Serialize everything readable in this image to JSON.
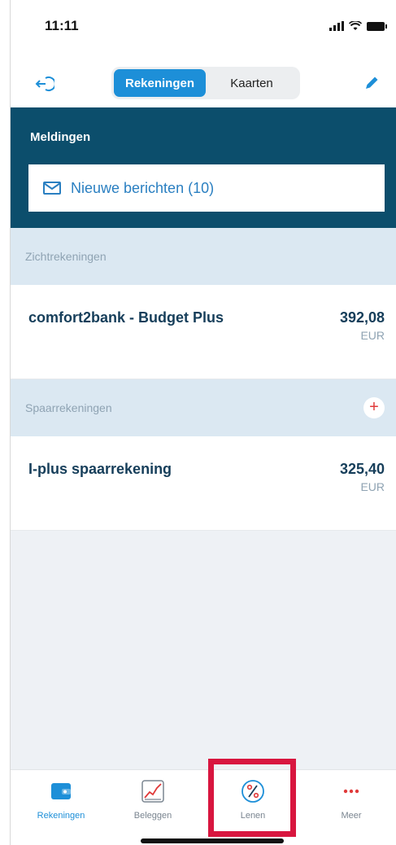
{
  "status_bar": {
    "time": "11:11"
  },
  "header": {
    "tabs": [
      {
        "label": "Rekeningen",
        "active": true
      },
      {
        "label": "Kaarten",
        "active": false
      }
    ]
  },
  "notifications": {
    "title": "Meldingen",
    "message": "Nieuwe berichten (10)"
  },
  "sections": [
    {
      "title": "Zichtrekeningen",
      "accounts": [
        {
          "name": "comfort2bank - Budget Plus",
          "amount": "392,08",
          "currency": "EUR"
        }
      ]
    },
    {
      "title": "Spaarrekeningen",
      "add_label": "+",
      "accounts": [
        {
          "name": "I-plus spaarrekening",
          "amount": "325,40",
          "currency": "EUR"
        }
      ]
    }
  ],
  "tab_bar": {
    "items": [
      {
        "label": "Rekeningen",
        "icon": "wallet-icon",
        "active": true
      },
      {
        "label": "Beleggen",
        "icon": "chart-icon",
        "active": false
      },
      {
        "label": "Lenen",
        "icon": "percent-icon",
        "active": false,
        "highlighted": true
      },
      {
        "label": "Meer",
        "icon": "more-icon",
        "active": false
      }
    ]
  },
  "colors": {
    "accent": "#1d8fd8",
    "header_bg": "#0c4e6c",
    "section_bg": "#dbe8f2",
    "highlight": "#d8163f",
    "text_dark": "#163e5a"
  }
}
